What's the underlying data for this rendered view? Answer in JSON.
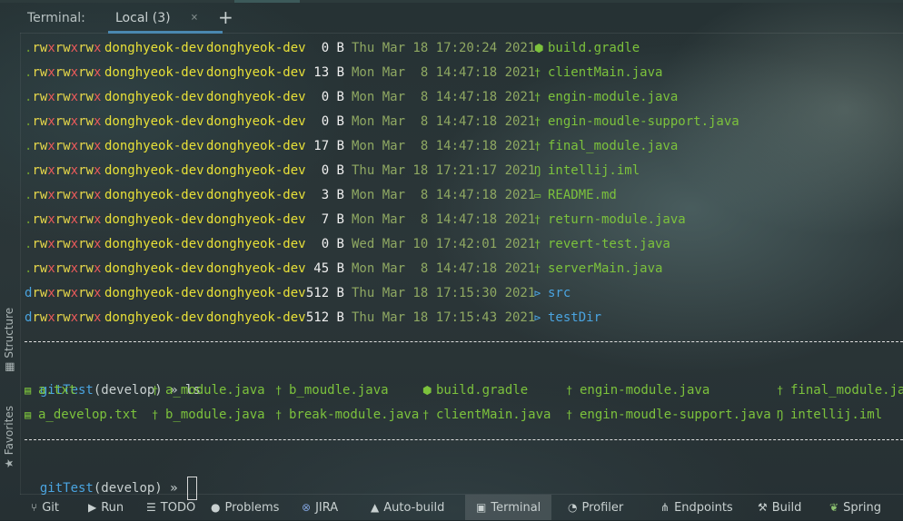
{
  "tabbar": {
    "label": "Terminal:",
    "active_tab": "Local (3)",
    "close_glyph": "×",
    "add_glyph": "+"
  },
  "sidebar": {
    "structure": "Structure",
    "favorites": "Favorites"
  },
  "listing": [
    {
      "perm": ".rwxrwxrwx",
      "user": "donghyeok-dev",
      "group": "donghyeok-dev",
      "size": "0 B",
      "date": "Thu Mar 18 17:20:24 2021",
      "icon": "gradle-icon",
      "name": "build.gradle",
      "type": "file"
    },
    {
      "perm": ".rwxrwxrwx",
      "user": "donghyeok-dev",
      "group": "donghyeok-dev",
      "size": "13 B",
      "date": "Mon Mar  8 14:47:18 2021",
      "icon": "java-icon",
      "name": "clientMain.java",
      "type": "file"
    },
    {
      "perm": ".rwxrwxrwx",
      "user": "donghyeok-dev",
      "group": "donghyeok-dev",
      "size": "0 B",
      "date": "Mon Mar  8 14:47:18 2021",
      "icon": "java-icon",
      "name": "engin-module.java",
      "type": "file"
    },
    {
      "perm": ".rwxrwxrwx",
      "user": "donghyeok-dev",
      "group": "donghyeok-dev",
      "size": "0 B",
      "date": "Mon Mar  8 14:47:18 2021",
      "icon": "java-icon",
      "name": "engin-moudle-support.java",
      "type": "file"
    },
    {
      "perm": ".rwxrwxrwx",
      "user": "donghyeok-dev",
      "group": "donghyeok-dev",
      "size": "17 B",
      "date": "Mon Mar  8 14:47:18 2021",
      "icon": "java-icon",
      "name": "final_module.java",
      "type": "file"
    },
    {
      "perm": ".rwxrwxrwx",
      "user": "donghyeok-dev",
      "group": "donghyeok-dev",
      "size": "0 B",
      "date": "Thu Mar 18 17:21:17 2021",
      "icon": "intellij-icon",
      "name": "intellij.iml",
      "type": "file"
    },
    {
      "perm": ".rwxrwxrwx",
      "user": "donghyeok-dev",
      "group": "donghyeok-dev",
      "size": "3 B",
      "date": "Mon Mar  8 14:47:18 2021",
      "icon": "markdown-icon",
      "name": "README.md",
      "type": "file"
    },
    {
      "perm": ".rwxrwxrwx",
      "user": "donghyeok-dev",
      "group": "donghyeok-dev",
      "size": "7 B",
      "date": "Mon Mar  8 14:47:18 2021",
      "icon": "java-icon",
      "name": "return-module.java",
      "type": "file"
    },
    {
      "perm": ".rwxrwxrwx",
      "user": "donghyeok-dev",
      "group": "donghyeok-dev",
      "size": "0 B",
      "date": "Wed Mar 10 17:42:01 2021",
      "icon": "java-icon",
      "name": "revert-test.java",
      "type": "file"
    },
    {
      "perm": ".rwxrwxrwx",
      "user": "donghyeok-dev",
      "group": "donghyeok-dev",
      "size": "45 B",
      "date": "Mon Mar  8 14:47:18 2021",
      "icon": "java-icon",
      "name": "serverMain.java",
      "type": "file"
    },
    {
      "perm": "drwxrwxrwx",
      "user": "donghyeok-dev",
      "group": "donghyeok-dev",
      "size": "512 B",
      "date": "Thu Mar 18 17:15:30 2021",
      "icon": "folder-icon",
      "name": "src",
      "type": "dir"
    },
    {
      "perm": "drwxrwxrwx",
      "user": "donghyeok-dev",
      "group": "donghyeok-dev",
      "size": "512 B",
      "date": "Thu Mar 18 17:15:43 2021",
      "icon": "folder-icon",
      "name": "testDir",
      "type": "dir"
    }
  ],
  "prompt1": {
    "dir": "gitTest",
    "branch": "(develop)",
    "arrow": "»",
    "cmd": "ls"
  },
  "ls_output": [
    [
      {
        "icon": "text-file-icon",
        "name": "a.txt"
      },
      {
        "icon": "java-icon",
        "name": "a_module.java"
      },
      {
        "icon": "java-icon",
        "name": "b_moudle.java"
      },
      {
        "icon": "gradle-icon",
        "name": "build.gradle"
      },
      {
        "icon": "java-icon",
        "name": "engin-module.java"
      },
      {
        "icon": "java-icon",
        "name": "final_module.java"
      }
    ],
    [
      {
        "icon": "text-file-icon",
        "name": "a_develop.txt"
      },
      {
        "icon": "java-icon",
        "name": "b_module.java"
      },
      {
        "icon": "java-icon",
        "name": "break-module.java"
      },
      {
        "icon": "java-icon",
        "name": "clientMain.java"
      },
      {
        "icon": "java-icon",
        "name": "engin-moudle-support.java"
      },
      {
        "icon": "intellij-icon",
        "name": "intellij.iml"
      }
    ]
  ],
  "prompt2": {
    "dir": "gitTest",
    "branch": "(develop)",
    "arrow": "»"
  },
  "bottombar": {
    "git": "Git",
    "run": "Run",
    "todo": "TODO",
    "problems": "Problems",
    "jira": "JIRA",
    "autobuild": "Auto-build",
    "terminal": "Terminal",
    "profiler": "Profiler",
    "endpoints": "Endpoints",
    "build": "Build",
    "spring": "Spring"
  }
}
